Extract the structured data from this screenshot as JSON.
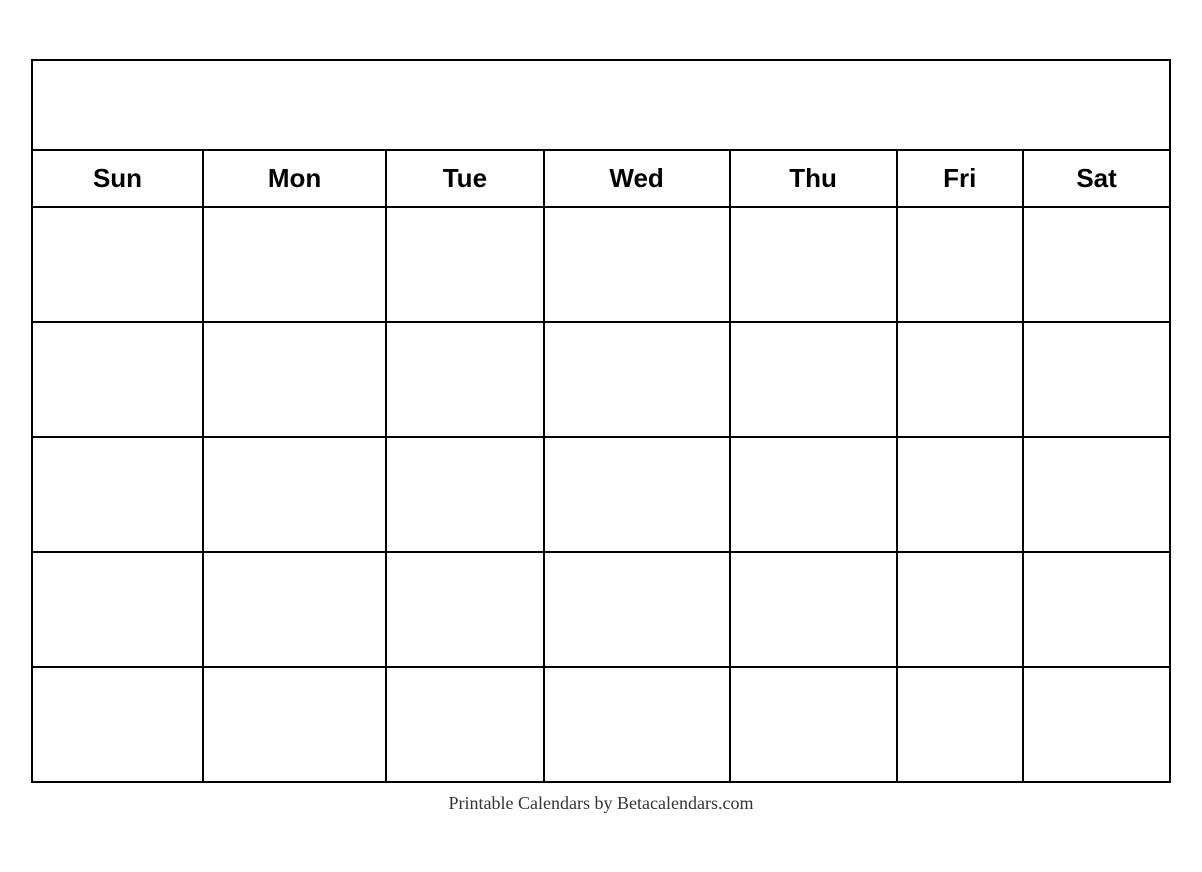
{
  "calendar": {
    "title": "",
    "days": [
      "Sun",
      "Mon",
      "Tue",
      "Wed",
      "Thu",
      "Fri",
      "Sat"
    ],
    "rows": 5
  },
  "footer": {
    "text": "Printable Calendars by Betacalendars.com"
  }
}
